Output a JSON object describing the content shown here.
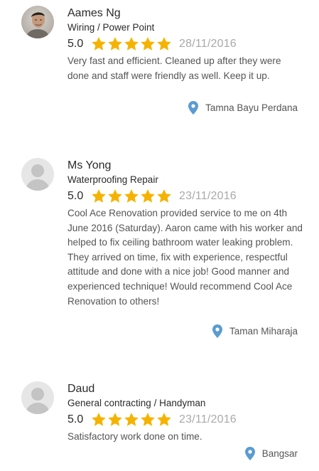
{
  "reviews": [
    {
      "name": "Aames Ng",
      "service": "Wiring / Power Point",
      "rating": "5.0",
      "stars": 5,
      "date": "28/11/2016",
      "comment": "Very fast and efficient. Cleaned up after they were done and staff were friendly as well. Keep it up.",
      "location": "Tamna Bayu Perdana",
      "avatar": "photo"
    },
    {
      "name": "Ms Yong",
      "service": "Waterproofing Repair",
      "rating": "5.0",
      "stars": 5,
      "date": "23/11/2016",
      "comment": "Cool Ace Renovation provided service to me on 4th June 2016 (Saturday). Aaron came with his worker and helped to fix ceiling bathroom water leaking problem. They arrived on time, fix with experience, respectful attitude and done with a nice job! Good manner and experienced technique! Would recommend Cool Ace Renovation to others!",
      "location": "Taman Miharaja",
      "avatar": "placeholder"
    },
    {
      "name": "Daud",
      "service": "General contracting / Handyman",
      "rating": "5.0",
      "stars": 5,
      "date": "23/11/2016",
      "comment": "Satisfactory work done on time.",
      "location": "Bangsar",
      "avatar": "placeholder"
    }
  ],
  "colors": {
    "star": "#f5b301",
    "pin": "#5b9bd1",
    "date": "#a9a9a9",
    "comment": "#545454"
  },
  "icons": {
    "star": "star-icon",
    "location": "map-pin-icon",
    "avatar": "user-avatar"
  }
}
